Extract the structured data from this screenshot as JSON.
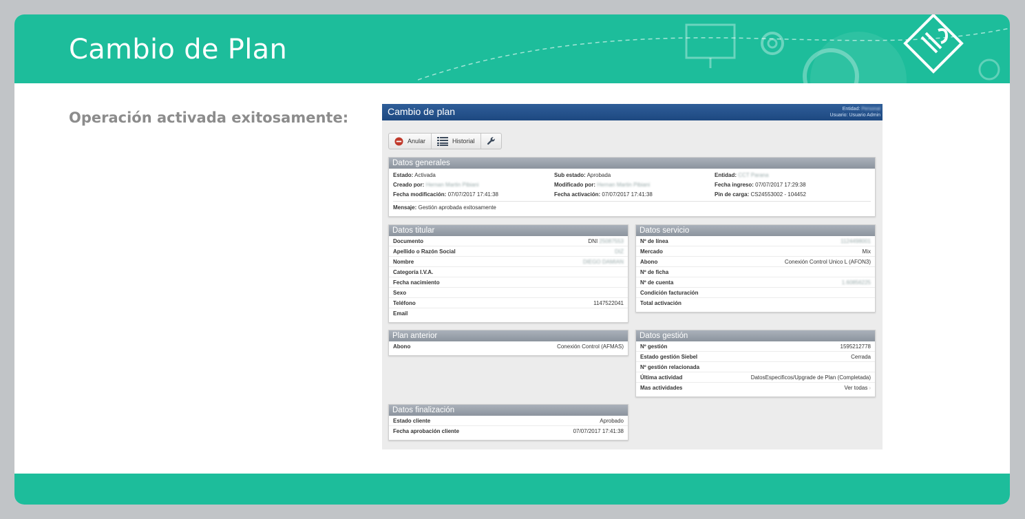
{
  "slide": {
    "title": "Cambio de Plan",
    "subtitle": "Operación activada exitosamente:",
    "colors": {
      "accent": "#1dbd9b",
      "background": "#c1c4c7"
    }
  },
  "app": {
    "title": "Cambio de plan",
    "entidad_label": "Entidad:",
    "entidad_value": "Personal",
    "usuario_label": "Usuario:",
    "usuario_value": "Usuario Admin"
  },
  "toolbar": {
    "anular": "Anular",
    "historial": "Historial"
  },
  "datos_generales": {
    "title": "Datos generales",
    "estado_label": "Estado:",
    "estado": "Activada",
    "sub_estado_label": "Sub estado:",
    "sub_estado": "Aprobada",
    "entidad_label": "Entidad:",
    "entidad": "CCT Parana",
    "creado_label": "Creado por:",
    "creado": "Hernan Martin Pibiani",
    "modificado_label": "Modificado por:",
    "modificado": "Hernan Martin Pibiani",
    "fecha_ingreso_label": "Fecha ingreso:",
    "fecha_ingreso": "07/07/2017 17:29:38",
    "fecha_mod_label": "Fecha modificación:",
    "fecha_mod": "07/07/2017 17:41:38",
    "fecha_act_label": "Fecha activación:",
    "fecha_act": "07/07/2017 17:41:38",
    "pin_label": "Pin de carga:",
    "pin": "CS24553002 - 104452",
    "mensaje_label": "Mensaje:",
    "mensaje": "Gestión aprobada exitosamente"
  },
  "datos_titular": {
    "title": "Datos titular",
    "rows": [
      {
        "k": "Documento",
        "v": "DNI",
        "blur": "25087553"
      },
      {
        "k": "Apellido o Razón Social",
        "v": "",
        "blur": "DIZ"
      },
      {
        "k": "Nombre",
        "v": "",
        "blur": "DIEGO DAMIAN"
      },
      {
        "k": "Categoría I.V.A.",
        "v": "",
        "blur": ""
      },
      {
        "k": "Fecha nacimiento",
        "v": "",
        "blur": ""
      },
      {
        "k": "Sexo",
        "v": "",
        "blur": ""
      },
      {
        "k": "Teléfono",
        "v": "1147522041",
        "blur": ""
      },
      {
        "k": "Email",
        "v": "",
        "blur": ""
      }
    ]
  },
  "datos_servicio": {
    "title": "Datos servicio",
    "rows": [
      {
        "k": "Nº de línea",
        "v": "",
        "blur": "1124498001"
      },
      {
        "k": "Mercado",
        "v": "Mix",
        "blur": ""
      },
      {
        "k": "Abono",
        "v": "Conexión Control Unico L (AFON3)",
        "blur": ""
      },
      {
        "k": "Nº de ficha",
        "v": "",
        "blur": ""
      },
      {
        "k": "Nº de cuenta",
        "v": "",
        "blur": "1.60856225"
      },
      {
        "k": "Condición facturación",
        "v": "",
        "blur": ""
      },
      {
        "k": "Total activación",
        "v": "",
        "blur": ""
      }
    ]
  },
  "plan_anterior": {
    "title": "Plan anterior",
    "rows": [
      {
        "k": "Abono",
        "v": "Conexión Control (AFMAS)"
      }
    ]
  },
  "datos_gestion": {
    "title": "Datos gestión",
    "rows": [
      {
        "k": "Nº gestión",
        "v": "1595212778"
      },
      {
        "k": "Estado gestión Siebel",
        "v": "Cerrada"
      },
      {
        "k": "Nº gestión relacionada",
        "v": ""
      },
      {
        "k": "Última actividad",
        "v": "DatosEspecificos/Upgrade de Plan (Completada)"
      },
      {
        "k": "Mas actividades",
        "v": "Ver todas"
      }
    ]
  },
  "datos_finalizacion": {
    "title": "Datos finalización",
    "rows": [
      {
        "k": "Estado cliente",
        "v": "Aprobado"
      },
      {
        "k": "Fecha aprobación cliente",
        "v": "07/07/2017 17:41:38"
      }
    ]
  }
}
